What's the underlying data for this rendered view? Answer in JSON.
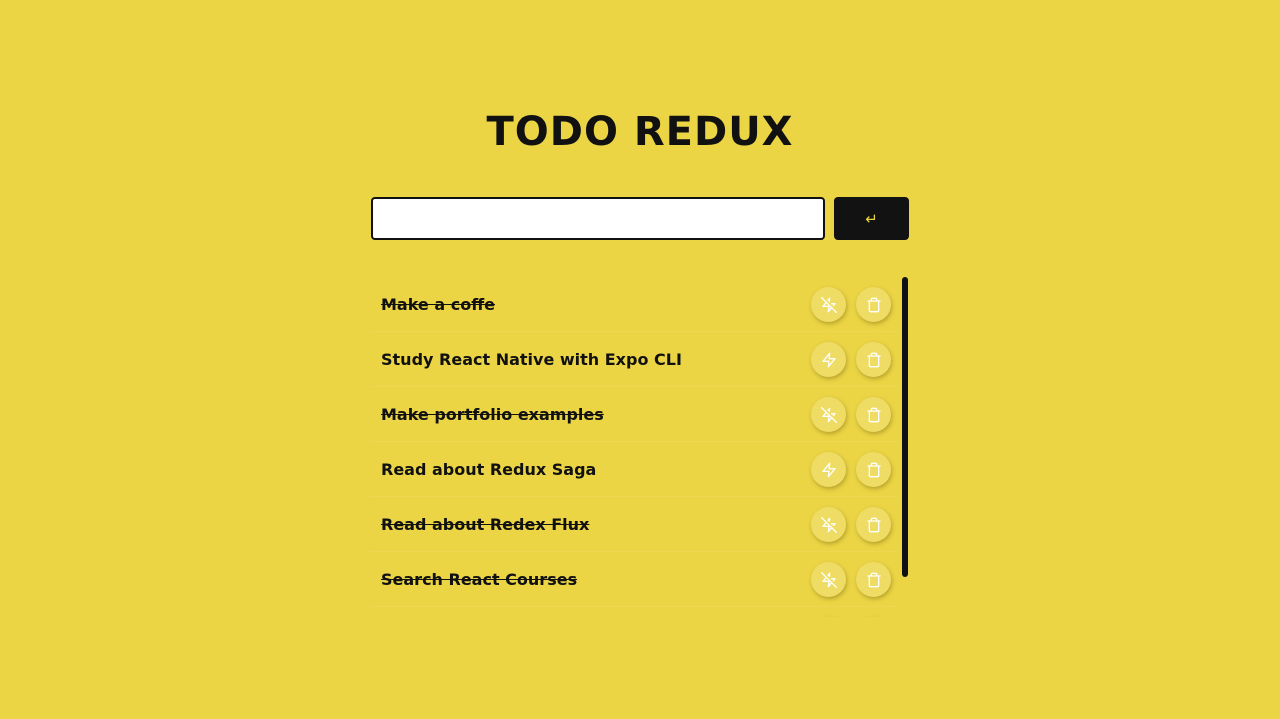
{
  "header": {
    "title": "TODO REDUX"
  },
  "form": {
    "input_value": "",
    "input_placeholder": "",
    "submit_label": "↵"
  },
  "todos": [
    {
      "text": "Make a coffe",
      "completed": true,
      "toggle_icon": "zap-off-icon",
      "delete_icon": "trash-icon"
    },
    {
      "text": "Study React Native with Expo CLI",
      "completed": false,
      "toggle_icon": "zap-icon",
      "delete_icon": "trash-icon"
    },
    {
      "text": "Make portfolio examples",
      "completed": true,
      "toggle_icon": "zap-off-icon",
      "delete_icon": "trash-icon"
    },
    {
      "text": "Read about Redux Saga",
      "completed": false,
      "toggle_icon": "zap-icon",
      "delete_icon": "trash-icon"
    },
    {
      "text": "Read about Redex Flux",
      "completed": true,
      "toggle_icon": "zap-off-icon",
      "delete_icon": "trash-icon"
    },
    {
      "text": "Search React Courses",
      "completed": true,
      "toggle_icon": "zap-off-icon",
      "delete_icon": "trash-icon"
    },
    {
      "text": "",
      "completed": false,
      "toggle_icon": "zap-icon",
      "delete_icon": "trash-icon"
    }
  ],
  "colors": {
    "background": "#EBD545",
    "button_dark": "#121212",
    "text": "#111111",
    "icon": "#FFFFFF"
  }
}
